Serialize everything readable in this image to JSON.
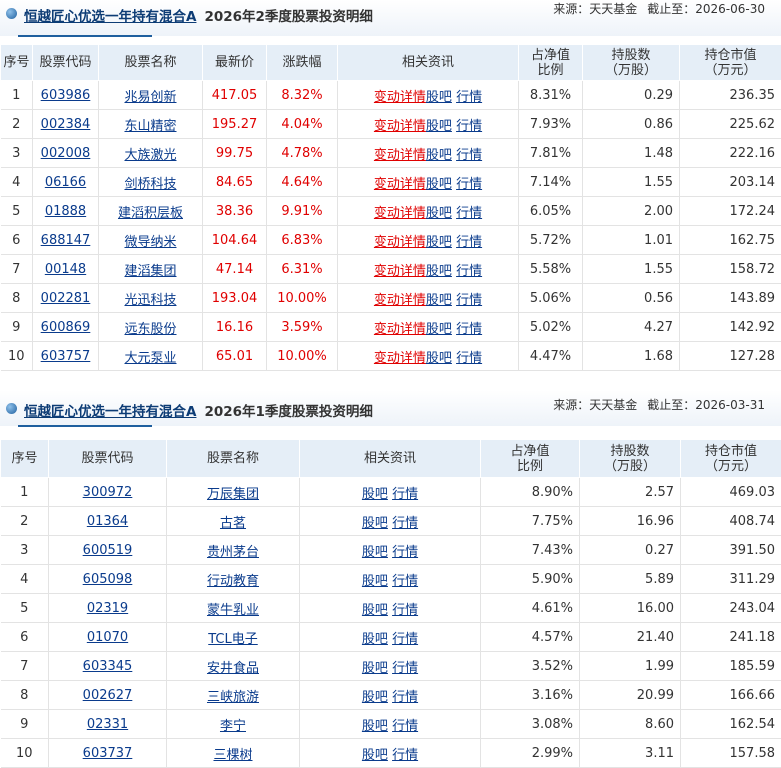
{
  "q2": {
    "fund_name": "恒越匠心优选一年持有混合A",
    "subtitle": "2026年2季度股票投资明细",
    "source": "来源：天天基金",
    "deadline": "截止至：2026-06-30",
    "headers": [
      "序号",
      "股票代码",
      "股票名称",
      "最新价",
      "涨跌幅",
      "相关资讯",
      "占净值比例",
      "持股数（万股）",
      "持仓市值（万元）"
    ],
    "rows": [
      {
        "no": "1",
        "code": "603986",
        "name": "兆易创新",
        "price": "417.05",
        "chg": "8.32%",
        "news": [
          "变动详情",
          "股吧",
          "行情"
        ],
        "pct": "8.31%",
        "shares": "0.29",
        "value": "236.35"
      },
      {
        "no": "2",
        "code": "002384",
        "name": "东山精密",
        "price": "195.27",
        "chg": "4.04%",
        "news": [
          "变动详情",
          "股吧",
          "行情"
        ],
        "pct": "7.93%",
        "shares": "0.86",
        "value": "225.62"
      },
      {
        "no": "3",
        "code": "002008",
        "name": "大族激光",
        "price": "99.75",
        "chg": "4.78%",
        "news": [
          "变动详情",
          "股吧",
          "行情"
        ],
        "pct": "7.81%",
        "shares": "1.48",
        "value": "222.16"
      },
      {
        "no": "4",
        "code": "06166",
        "name": "剑桥科技",
        "price": "84.65",
        "chg": "4.64%",
        "news": [
          "变动详情",
          "股吧",
          "行情"
        ],
        "pct": "7.14%",
        "shares": "1.55",
        "value": "203.14"
      },
      {
        "no": "5",
        "code": "01888",
        "name": "建滔积层板",
        "price": "38.36",
        "chg": "9.91%",
        "news": [
          "变动详情",
          "股吧",
          "行情"
        ],
        "pct": "6.05%",
        "shares": "2.00",
        "value": "172.24"
      },
      {
        "no": "6",
        "code": "688147",
        "name": "微导纳米",
        "price": "104.64",
        "chg": "6.83%",
        "news": [
          "变动详情",
          "股吧",
          "行情"
        ],
        "pct": "5.72%",
        "shares": "1.01",
        "value": "162.75"
      },
      {
        "no": "7",
        "code": "00148",
        "name": "建滔集团",
        "price": "47.14",
        "chg": "6.31%",
        "news": [
          "变动详情",
          "股吧",
          "行情"
        ],
        "pct": "5.58%",
        "shares": "1.55",
        "value": "158.72"
      },
      {
        "no": "8",
        "code": "002281",
        "name": "光迅科技",
        "price": "193.04",
        "chg": "10.00%",
        "news": [
          "变动详情",
          "股吧",
          "行情"
        ],
        "pct": "5.06%",
        "shares": "0.56",
        "value": "143.89"
      },
      {
        "no": "9",
        "code": "600869",
        "name": "远东股份",
        "price": "16.16",
        "chg": "3.59%",
        "news": [
          "变动详情",
          "股吧",
          "行情"
        ],
        "pct": "5.02%",
        "shares": "4.27",
        "value": "142.92"
      },
      {
        "no": "10",
        "code": "603757",
        "name": "大元泵业",
        "price": "65.01",
        "chg": "10.00%",
        "news": [
          "变动详情",
          "股吧",
          "行情"
        ],
        "pct": "4.47%",
        "shares": "1.68",
        "value": "127.28"
      }
    ]
  },
  "q1": {
    "fund_name": "恒越匠心优选一年持有混合A",
    "subtitle": "2026年1季度股票投资明细",
    "source": "来源：天天基金",
    "deadline": "截止至：2026-03-31",
    "headers": [
      "序号",
      "股票代码",
      "股票名称",
      "相关资讯",
      "占净值比例",
      "持股数（万股）",
      "持仓市值（万元）"
    ],
    "rows": [
      {
        "no": "1",
        "code": "300972",
        "name": "万辰集团",
        "news": [
          "股吧",
          "行情"
        ],
        "pct": "8.90%",
        "shares": "2.57",
        "value": "469.03"
      },
      {
        "no": "2",
        "code": "01364",
        "name": "古茗",
        "news": [
          "股吧",
          "行情"
        ],
        "pct": "7.75%",
        "shares": "16.96",
        "value": "408.74"
      },
      {
        "no": "3",
        "code": "600519",
        "name": "贵州茅台",
        "news": [
          "股吧",
          "行情"
        ],
        "pct": "7.43%",
        "shares": "0.27",
        "value": "391.50"
      },
      {
        "no": "4",
        "code": "605098",
        "name": "行动教育",
        "news": [
          "股吧",
          "行情"
        ],
        "pct": "5.90%",
        "shares": "5.89",
        "value": "311.29"
      },
      {
        "no": "5",
        "code": "02319",
        "name": "蒙牛乳业",
        "news": [
          "股吧",
          "行情"
        ],
        "pct": "4.61%",
        "shares": "16.00",
        "value": "243.04"
      },
      {
        "no": "6",
        "code": "01070",
        "name": "TCL电子",
        "news": [
          "股吧",
          "行情"
        ],
        "pct": "4.57%",
        "shares": "21.40",
        "value": "241.18"
      },
      {
        "no": "7",
        "code": "603345",
        "name": "安井食品",
        "news": [
          "股吧",
          "行情"
        ],
        "pct": "3.52%",
        "shares": "1.99",
        "value": "185.59"
      },
      {
        "no": "8",
        "code": "002627",
        "name": "三峡旅游",
        "news": [
          "股吧",
          "行情"
        ],
        "pct": "3.16%",
        "shares": "20.99",
        "value": "166.66"
      },
      {
        "no": "9",
        "code": "02331",
        "name": "李宁",
        "news": [
          "股吧",
          "行情"
        ],
        "pct": "3.08%",
        "shares": "8.60",
        "value": "162.54"
      },
      {
        "no": "10",
        "code": "603737",
        "name": "三棵树",
        "news": [
          "股吧",
          "行情"
        ],
        "pct": "2.99%",
        "shares": "3.11",
        "value": "157.58"
      }
    ]
  }
}
